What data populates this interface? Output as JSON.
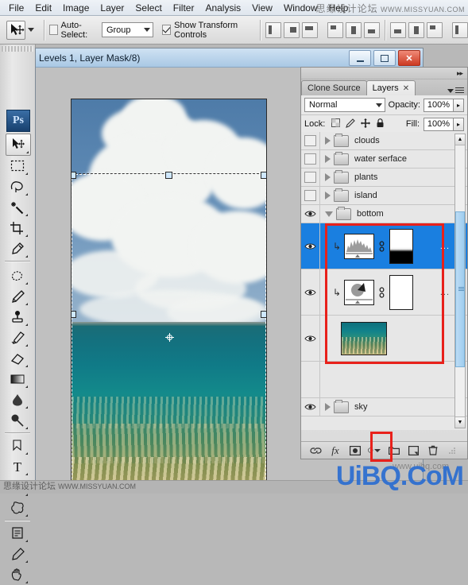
{
  "app": {
    "name": "Adobe Photoshop",
    "logo_text": "Ps"
  },
  "menubar": {
    "items": [
      {
        "label": "File"
      },
      {
        "label": "Edit"
      },
      {
        "label": "Image"
      },
      {
        "label": "Layer"
      },
      {
        "label": "Select"
      },
      {
        "label": "Filter"
      },
      {
        "label": "Analysis"
      },
      {
        "label": "View"
      },
      {
        "label": "Window"
      },
      {
        "label": "Help"
      }
    ]
  },
  "options_bar": {
    "tool_icon": "move-tool-icon",
    "auto_select_label": "Auto-Select:",
    "auto_select_checked": false,
    "auto_select_value": "Group",
    "show_transform_label": "Show Transform Controls",
    "show_transform_checked": true,
    "align_icons": [
      "align-left-edges-icon",
      "align-horizontal-centers-icon",
      "align-right-edges-icon",
      "align-top-edges-icon",
      "align-vertical-centers-icon",
      "align-bottom-edges-icon",
      "distribute-top-icon",
      "distribute-vertical-center-icon",
      "distribute-bottom-icon"
    ]
  },
  "toolbox": {
    "tools": [
      {
        "name": "move-tool",
        "selected": true
      },
      {
        "name": "rectangular-marquee-tool",
        "selected": false
      },
      {
        "name": "lasso-tool",
        "selected": false
      },
      {
        "name": "magic-wand-tool",
        "selected": false
      },
      {
        "name": "crop-tool",
        "selected": false
      },
      {
        "name": "eyedropper-tool",
        "selected": false
      },
      {
        "name": "healing-brush-tool",
        "selected": false
      },
      {
        "name": "brush-tool",
        "selected": false
      },
      {
        "name": "clone-stamp-tool",
        "selected": false
      },
      {
        "name": "history-brush-tool",
        "selected": false
      },
      {
        "name": "eraser-tool",
        "selected": false
      },
      {
        "name": "gradient-tool",
        "selected": false
      },
      {
        "name": "blur-tool",
        "selected": false
      },
      {
        "name": "dodge-tool",
        "selected": false
      },
      {
        "name": "pen-tool",
        "selected": false
      },
      {
        "name": "horizontal-type-tool",
        "selected": false
      },
      {
        "name": "path-selection-tool",
        "selected": false
      },
      {
        "name": "custom-shape-tool",
        "selected": false
      },
      {
        "name": "notes-tool",
        "selected": false
      },
      {
        "name": "eyedropper-secondary-tool",
        "selected": false
      },
      {
        "name": "hand-tool",
        "selected": false
      }
    ],
    "type_glyph": "T"
  },
  "document_window": {
    "title": "Levels 1, Layer Mask/8)",
    "minimize_label": "",
    "maximize_label": "",
    "close_label": "✕"
  },
  "canvas": {
    "description": "Cumulus clouds above tropical sea with underwater coral reef",
    "transform_selection_visible": true
  },
  "layers_panel": {
    "tabs": [
      {
        "label": "Clone Source",
        "active": false,
        "closable": false
      },
      {
        "label": "Layers",
        "active": true,
        "closable": true
      }
    ],
    "close_glyph": "✕",
    "blend_mode": "Normal",
    "opacity_label": "Opacity:",
    "opacity_value": "100%",
    "lock_label": "Lock:",
    "fill_label": "Fill:",
    "fill_value": "100%",
    "lock_icons": [
      "lock-transparent-pixels-icon",
      "lock-image-pixels-icon",
      "lock-position-icon",
      "lock-all-icon"
    ],
    "layers": [
      {
        "name": "clouds",
        "type": "group",
        "visible": false,
        "expanded": false,
        "selected": false
      },
      {
        "name": "water serface",
        "type": "group",
        "visible": false,
        "expanded": false,
        "selected": false
      },
      {
        "name": "plants",
        "type": "group",
        "visible": false,
        "expanded": false,
        "selected": false
      },
      {
        "name": "island",
        "type": "group",
        "visible": false,
        "expanded": false,
        "selected": false
      },
      {
        "name": "bottom",
        "type": "group",
        "visible": true,
        "expanded": true,
        "selected": false
      },
      {
        "name": "",
        "type": "levels-adjustment",
        "visible": true,
        "clipped": true,
        "selected": true,
        "thumb": "histogram",
        "mask": "black-white-gradient-mask",
        "extra": "..."
      },
      {
        "name": "",
        "type": "curves-adjustment",
        "visible": true,
        "clipped": true,
        "selected": false,
        "thumb": "curve-pie",
        "mask": "white-mask",
        "extra": "..."
      },
      {
        "name": "",
        "type": "image",
        "visible": true,
        "clipped": false,
        "selected": false,
        "thumb": "reef-photo"
      },
      {
        "name": "sky",
        "type": "group",
        "visible": true,
        "expanded": false,
        "selected": false
      }
    ],
    "footer_icons": [
      {
        "name": "link-layers-icon",
        "glyph": "⚭"
      },
      {
        "name": "add-layer-style-icon",
        "glyph": "fx"
      },
      {
        "name": "add-layer-mask-icon",
        "glyph": "▢"
      },
      {
        "name": "create-adjustment-layer-icon",
        "glyph": "◐",
        "highlighted": true
      },
      {
        "name": "create-group-icon",
        "glyph": "❐"
      },
      {
        "name": "create-new-layer-icon",
        "glyph": "⬒"
      },
      {
        "name": "delete-layer-icon",
        "glyph": "Ὕ1"
      }
    ],
    "scrollbar": {
      "up_glyph": "▲",
      "down_glyph": "▼"
    }
  },
  "annotations": {
    "layer_group_highlight": "red rectangle around clipped adjustment layers and base image layer",
    "adjustment_button_highlight": "red rectangle around create-adjustment-layer button"
  },
  "watermarks": {
    "top_right_cn": "思缘设计论坛",
    "top_right_en": "WWW.MISSYUAN.COM",
    "bottom_left_cn": "思缘设计论坛",
    "bottom_left_en": "WWW.MISSYUAN.COM",
    "bottom_right": "UiBQ.CoM",
    "bottom_right_small": "www.uibq.com"
  }
}
